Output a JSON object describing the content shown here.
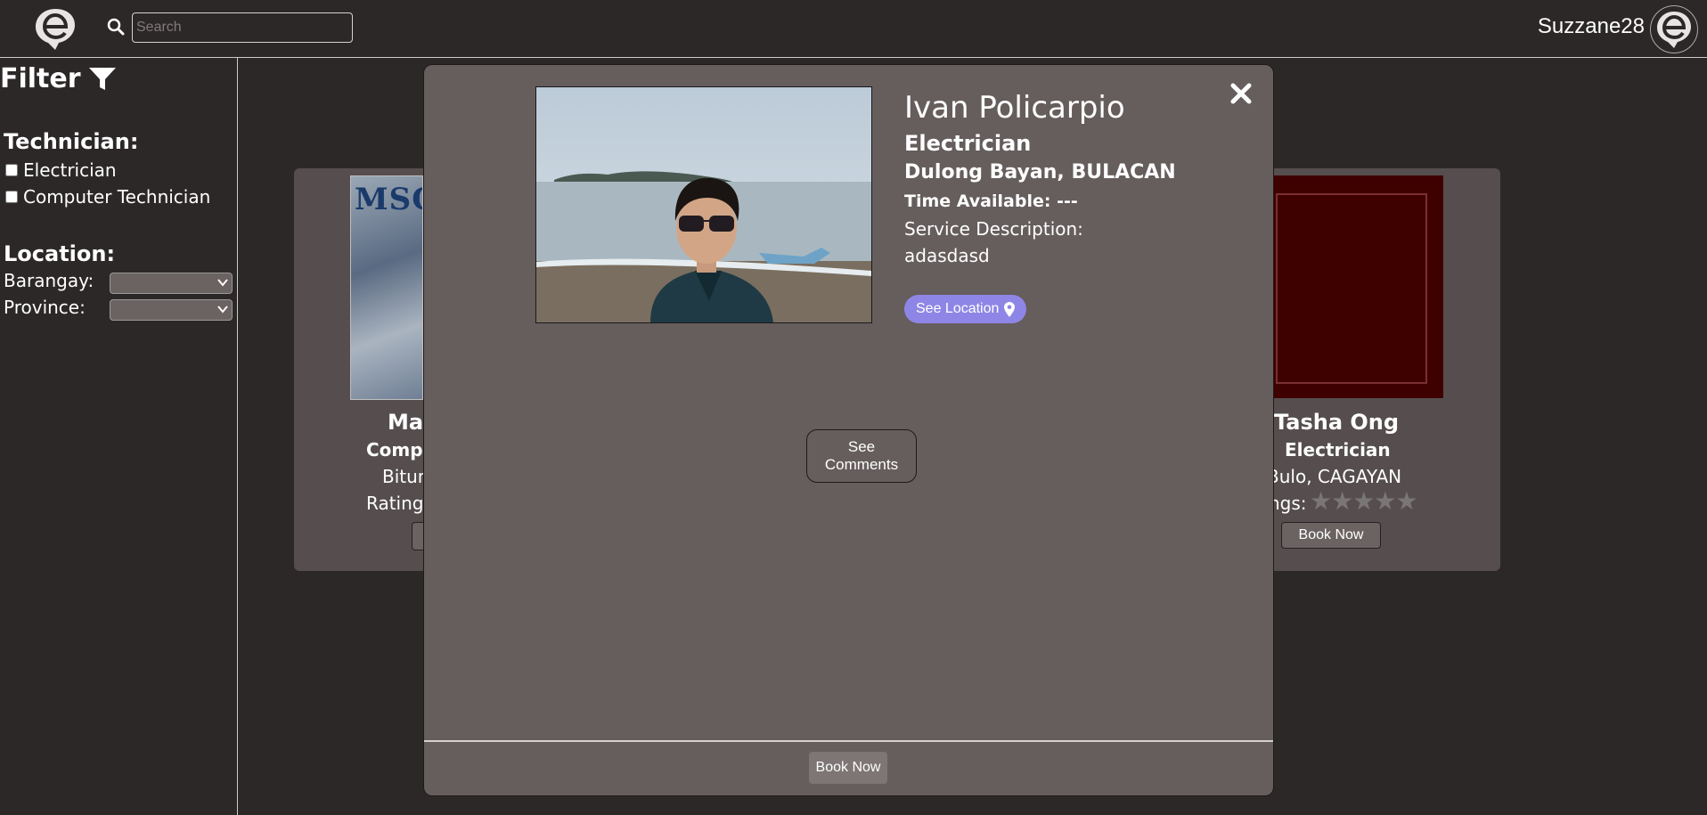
{
  "header": {
    "search_placeholder": "Search",
    "username": "Suzzane28",
    "logo_icon": "e-logo-icon",
    "search_icon": "search-icon"
  },
  "sidebar": {
    "filter_title": "Filter",
    "filter_icon": "funnel-icon",
    "technician_title": "Technician:",
    "technician_options": [
      "Electrician",
      "Computer Technician"
    ],
    "location_title": "Location:",
    "barangay_label": "Barangay:",
    "province_label": "Province:"
  },
  "cards": {
    "left": {
      "image_text": "MSCPE",
      "name_partial": "Mar",
      "type_partial": "Comp",
      "location_partial": "Bitun",
      "ratings_partial": "Rating"
    },
    "right": {
      "name": "Tasha Ong",
      "type": "Electrician",
      "location_partial": "Bulo, CAGAYAN",
      "ratings_partial": "ngs:",
      "stars_filled": 0,
      "stars_total": 5,
      "book_label": "Book Now"
    }
  },
  "modal": {
    "name": "Ivan Policarpio",
    "type": "Electrician",
    "location": "Dulong Bayan, BULACAN",
    "time_available": "Time Available: ---",
    "service_description_label": "Service Description:",
    "service_description": "adasdasd",
    "see_location_label": "See Location",
    "see_comments_label": "See Comments",
    "book_label": "Book Now",
    "close_icon": "close-icon",
    "location_icon": "map-pin-icon"
  },
  "colors": {
    "background": "#2d2828",
    "modal": "#665d5d",
    "card": "#564e4e",
    "accent": "#8e86e6"
  }
}
